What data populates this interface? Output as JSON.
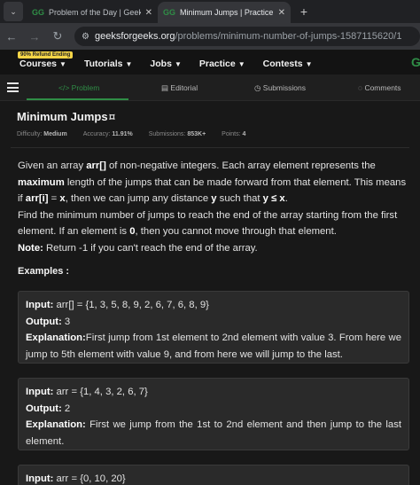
{
  "browser": {
    "tabs": [
      {
        "title": "Problem of the Day | GeeksforG",
        "active": false
      },
      {
        "title": "Minimum Jumps | Practice | Gee",
        "active": true
      }
    ],
    "new_tab_label": "+",
    "url_host": "geeksforgeeks.org",
    "url_path": "/problems/minimum-number-of-jumps-1587115620/1"
  },
  "site_nav": {
    "refund_badge": "90% Refund Ending",
    "items": [
      "Courses",
      "Tutorials",
      "Jobs",
      "Practice",
      "Contests"
    ]
  },
  "problem_tabs": {
    "problem": "Problem",
    "editorial": "Editorial",
    "submissions": "Submissions",
    "comments": "Comments"
  },
  "problem": {
    "title": "Minimum Jumps",
    "difficulty_label": "Difficulty:",
    "difficulty": "Medium",
    "accuracy_label": "Accuracy:",
    "accuracy": "11.91%",
    "submissions_label": "Submissions:",
    "submissions": "853K+",
    "points_label": "Points:",
    "points": "4"
  },
  "description": {
    "p1_a": "Given an array ",
    "p1_arr": "arr[]",
    "p1_b": " of non-negative integers. Each array element represents the ",
    "p1_max": "maximum",
    "p1_c": " length of the jumps that can be made forward from that element. This means if ",
    "p1_arri": "arr[i]",
    "p1_d": " = ",
    "p1_x": "x",
    "p1_e": ", then we can jump any distance ",
    "p1_y": "y",
    "p1_f": " such that ",
    "p1_ylex": "y ≤ x",
    "p1_g": ".",
    "p2_a": "Find the minimum number of jumps to reach the end of the array starting from the first element. If an element is ",
    "p2_zero": "0",
    "p2_b": ", then you cannot move through that element.",
    "note_label": "Note:",
    "note_text": "  Return -1 if you can't reach the end of the array."
  },
  "examples_label": "Examples :",
  "examples": [
    {
      "input_label": "Input:",
      "input": " arr[] = {1, 3, 5, 8, 9, 2, 6, 7, 6, 8, 9}",
      "output_label": "Output:",
      "output": " 3",
      "explanation_label": "Explanation:",
      "explanation": "First jump from 1st element to 2nd element with value 3. From here we jump to 5th element with value 9, and from here we will jump to the last."
    },
    {
      "input_label": "Input:",
      "input": " arr = {1, 4, 3, 2, 6, 7}",
      "output_label": "Output:",
      "output": " 2",
      "explanation_label": "Explanation:",
      "explanation": " First we jump from the 1st to 2nd element and then jump to the last element."
    },
    {
      "input_label": "Input:",
      "input": " arr = {0, 10, 20}"
    }
  ]
}
